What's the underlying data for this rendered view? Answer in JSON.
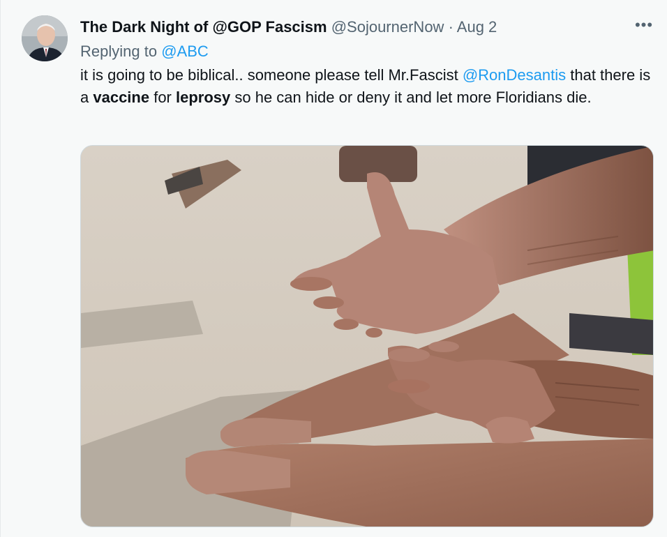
{
  "tweet": {
    "author_name": "The Dark Night of @GOP Fascism",
    "author_handle": "@SojournerNow",
    "separator": "·",
    "date": "Aug 2",
    "more_icon": "ellipsis-icon",
    "replying_prefix": "Replying to",
    "replying_to": "@ABC",
    "text_part1": "it is going to be biblical.. someone please tell Mr.Fascist ",
    "mention": "@RonDesantis",
    "text_part2": " that there is a ",
    "bold1": "vaccine",
    "text_part3": " for ",
    "bold2": "leprosy",
    "text_part4": " so he can hide or deny it and let more Floridians die.",
    "media": {
      "type": "photo"
    }
  },
  "colors": {
    "link": "#1d9bf0",
    "secondary_text": "#536471",
    "primary_text": "#0f1419",
    "background": "#f7f9f9"
  }
}
